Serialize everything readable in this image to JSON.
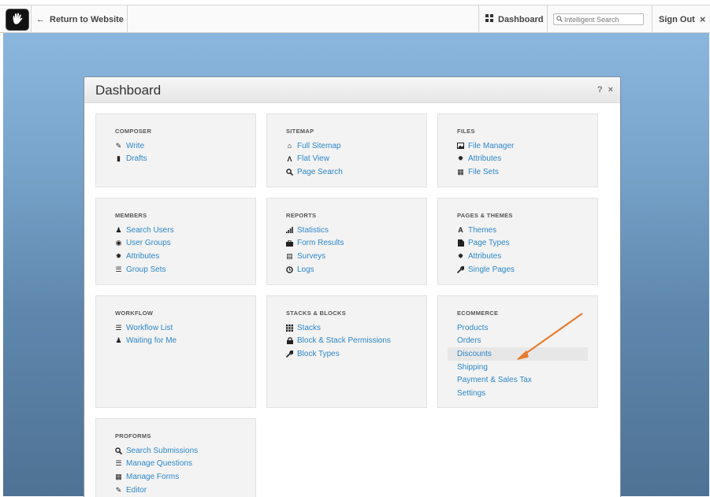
{
  "toolbar": {
    "return_label": "Return to Website",
    "dashboard_label": "Dashboard",
    "search_placeholder": "Intelligent Search",
    "signout_label": "Sign Out"
  },
  "panel": {
    "title": "Dashboard",
    "help": "?",
    "close": "×"
  },
  "sections": {
    "composer": {
      "title": "COMPOSER",
      "items": [
        {
          "label": "Write",
          "icon": "pencil-icon"
        },
        {
          "label": "Drafts",
          "icon": "document-icon"
        }
      ]
    },
    "sitemap": {
      "title": "SITEMAP",
      "items": [
        {
          "label": "Full Sitemap",
          "icon": "home-icon"
        },
        {
          "label": "Flat View",
          "icon": "road-icon"
        },
        {
          "label": "Page Search",
          "icon": "search-icon"
        }
      ]
    },
    "files": {
      "title": "FILES",
      "items": [
        {
          "label": "File Manager",
          "icon": "picture-icon"
        },
        {
          "label": "Attributes",
          "icon": "gear-icon"
        },
        {
          "label": "File Sets",
          "icon": "grid-icon"
        }
      ]
    },
    "members": {
      "title": "MEMBERS",
      "items": [
        {
          "label": "Search Users",
          "icon": "user-icon"
        },
        {
          "label": "User Groups",
          "icon": "globe-icon"
        },
        {
          "label": "Attributes",
          "icon": "gear-icon"
        },
        {
          "label": "Group Sets",
          "icon": "list-icon"
        }
      ]
    },
    "reports": {
      "title": "REPORTS",
      "items": [
        {
          "label": "Statistics",
          "icon": "signal-icon"
        },
        {
          "label": "Form Results",
          "icon": "briefcase-icon"
        },
        {
          "label": "Surveys",
          "icon": "hdd-icon"
        },
        {
          "label": "Logs",
          "icon": "clock-icon"
        }
      ]
    },
    "pages_themes": {
      "title": "PAGES & THEMES",
      "items": [
        {
          "label": "Themes",
          "icon": "font-icon"
        },
        {
          "label": "Page Types",
          "icon": "file-icon"
        },
        {
          "label": "Attributes",
          "icon": "gear-icon"
        },
        {
          "label": "Single Pages",
          "icon": "wrench-icon"
        }
      ]
    },
    "workflow": {
      "title": "WORKFLOW",
      "items": [
        {
          "label": "Workflow List",
          "icon": "list-icon"
        },
        {
          "label": "Waiting for Me",
          "icon": "user-icon"
        }
      ]
    },
    "stacks": {
      "title": "STACKS & BLOCKS",
      "items": [
        {
          "label": "Stacks",
          "icon": "th-icon"
        },
        {
          "label": "Block & Stack Permissions",
          "icon": "lock-icon"
        },
        {
          "label": "Block Types",
          "icon": "wrench-icon"
        }
      ]
    },
    "ecommerce": {
      "title": "ECOMMERCE",
      "items": [
        {
          "label": "Products"
        },
        {
          "label": "Orders"
        },
        {
          "label": "Discounts"
        },
        {
          "label": "Shipping"
        },
        {
          "label": "Payment & Sales Tax"
        },
        {
          "label": "Settings"
        }
      ]
    },
    "proforms": {
      "title": "PROFORMS",
      "items": [
        {
          "label": "Search Submissions",
          "icon": "search-icon"
        },
        {
          "label": "Manage Questions",
          "icon": "list-icon"
        },
        {
          "label": "Manage Forms",
          "icon": "form-icon"
        },
        {
          "label": "Editor",
          "icon": "pencil-icon"
        }
      ]
    }
  },
  "colors": {
    "link": "#2f87c9",
    "annotation_arrow": "#e57c30"
  }
}
